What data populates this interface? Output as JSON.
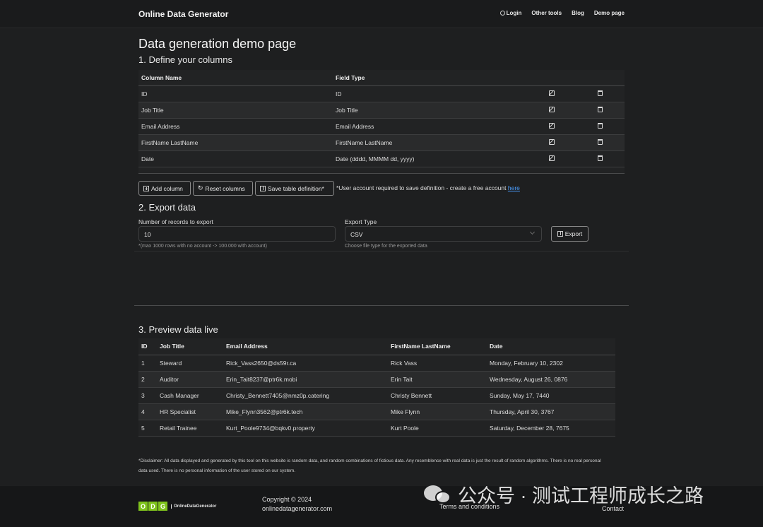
{
  "nav": {
    "brand": "Online Data Generator",
    "links": [
      "Login",
      "Other tools",
      "Blog",
      "Demo page"
    ]
  },
  "page_title": "Data generation demo page",
  "section1": {
    "title": "1. Define your columns",
    "headers": [
      "Column Name",
      "Field Type"
    ],
    "rows": [
      {
        "name": "ID",
        "type": "ID"
      },
      {
        "name": "Job Title",
        "type": "Job Title"
      },
      {
        "name": "Email Address",
        "type": "Email Address"
      },
      {
        "name": "FirstName LastName",
        "type": "FirstName LastName"
      },
      {
        "name": "Date",
        "type": "Date (dddd, MMMM dd, yyyy)"
      }
    ],
    "buttons": {
      "add": "Add column",
      "reset": "Reset columns",
      "save": "Save table definition*"
    },
    "note": "*User account required to save definition - create a free account",
    "note_link": "here"
  },
  "section2": {
    "title": "2. Export data",
    "records_label": "Number of records to export",
    "records_value": "10",
    "records_hint": "*(max 1000 rows with no account -> 100.000 with account)",
    "type_label": "Export Type",
    "type_value": "CSV",
    "type_hint": "Choose file type for the exported data",
    "export_button": "Export"
  },
  "section3": {
    "title": "3. Preview data live",
    "headers": [
      "ID",
      "Job Title",
      "Email Address",
      "FirstName LastName",
      "Date"
    ],
    "rows": [
      [
        "1",
        "Steward",
        "Rick_Vass2650@ds59r.ca",
        "Rick Vass",
        "Monday, February 10, 2302"
      ],
      [
        "2",
        "Auditor",
        "Erin_Tait8237@ptr6k.mobi",
        "Erin Tait",
        "Wednesday, August 26, 0876"
      ],
      [
        "3",
        "Cash Manager",
        "Christy_Bennett7405@nmz0p.catering",
        "Christy Bennett",
        "Sunday, May 17, 7440"
      ],
      [
        "4",
        "HR Specialist",
        "Mike_Flynn3562@ptr6k.tech",
        "Mike Flynn",
        "Thursday, April 30, 3767"
      ],
      [
        "5",
        "Retail Trainee",
        "Kurt_Poole9734@bqkv0.property",
        "Kurt Poole",
        "Saturday, December 28, 7675"
      ]
    ]
  },
  "disclaimer": "*Disclaimer: All data displayed and generated by this tool on this website is random data, and random combinations of fictious data. Any resemblence with real data is just the result of random algorithms. There is no real personal data used. There is no personal information of the user stored on our system.",
  "footer": {
    "logo_letters": [
      "O",
      "D",
      "G"
    ],
    "logo_text": "OnlineDataGenerator",
    "copyright": "Copyright © 2024",
    "domain": "onlinedatagenerator.com",
    "terms": "Terms and conditions",
    "contact": "Contact"
  },
  "watermark": "公众号 · 测试工程师成长之路",
  "colors": {
    "background": "#1e1f20",
    "navbar": "#1a1b1c",
    "footer": "#161718",
    "link": "#4a9eff",
    "logo_green": "#7fc31c"
  }
}
